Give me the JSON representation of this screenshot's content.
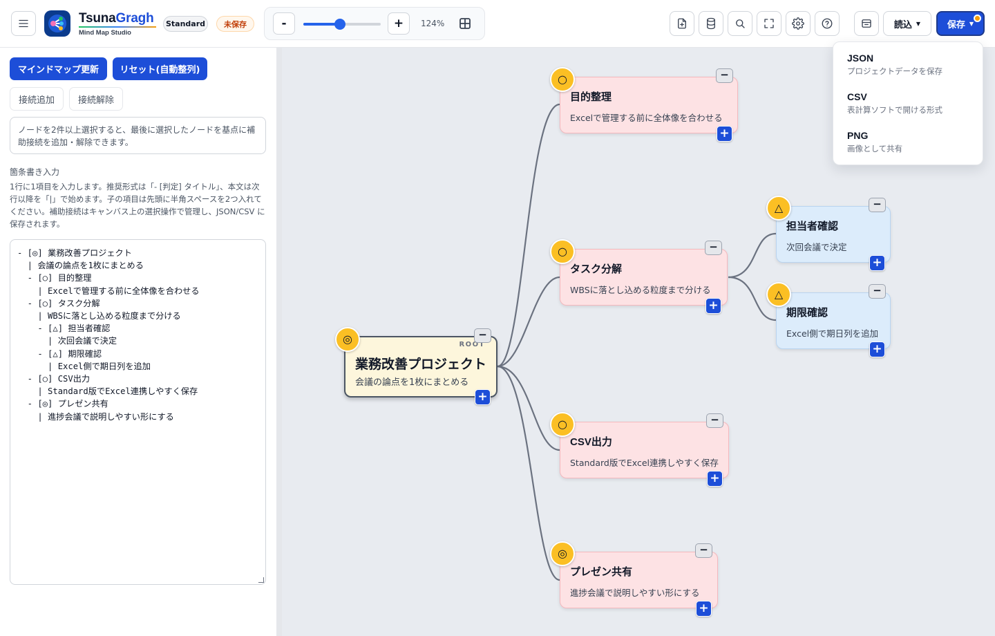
{
  "header": {
    "brand_name_1": "Tsuna",
    "brand_name_2": "Gragh",
    "brand_sub": "Mind Map Studio",
    "plan": "Standard",
    "status": "未保存",
    "zoom": {
      "minus": "-",
      "plus": "+",
      "value": "124%",
      "slider_fraction": 0.47
    },
    "read_label": "読込",
    "save_label": "保存",
    "caret": "▼"
  },
  "save_menu": {
    "items": [
      {
        "title": "JSON",
        "desc": "プロジェクトデータを保存"
      },
      {
        "title": "CSV",
        "desc": "表計算ソフトで開ける形式"
      },
      {
        "title": "PNG",
        "desc": "画像として共有"
      }
    ]
  },
  "sidebar": {
    "update_button": "マインドマップ更新",
    "reset_button": "リセット(自動整列)",
    "add_link_button": "接続追加",
    "remove_link_button": "接続解除",
    "hint": "ノードを2件以上選択すると、最後に選択したノードを基点に補助接続を追加・解除できます。",
    "section_title": "箇条書き入力",
    "section_desc": "1行に1項目を入力します。推奨形式は「- [判定] タイトル」、本文は次行以降を「|」で始めます。子の項目は先頭に半角スペースを2つ入れてください。補助接続はキャンバス上の選択操作で管理し、JSON/CSV に保存されます。",
    "editor_lines": [
      "- [◎] 業務改善プロジェクト",
      "  | 会議の論点を1枚にまとめる",
      "  - [○] 目的整理",
      "    | Excelで管理する前に全体像を合わせる",
      "  - [○] タスク分解",
      "    | WBSに落とし込める粒度まで分ける",
      "    - [△] 担当者確認",
      "      | 次回会議で決定",
      "    - [△] 期限確認",
      "      | Excel側で期日列を追加",
      "  - [○] CSV出力",
      "    | Standard版でExcel連携しやすく保存",
      "  - [◎] プレゼン共有",
      "    | 進捗会議で説明しやすい形にする"
    ]
  },
  "mindmap": {
    "root": {
      "label": "ROOT",
      "title": "業務改善プロジェクト",
      "body": "会議の論点を1枚にまとめる",
      "mark": "◎"
    },
    "nodes": [
      {
        "title": "目的整理",
        "body": "Excelで管理する前に全体像を合わせる",
        "mark": "○"
      },
      {
        "title": "タスク分解",
        "body": "WBSに落とし込める粒度まで分ける",
        "mark": "○"
      },
      {
        "title": "担当者確認",
        "body": "次回会議で決定",
        "mark": "△"
      },
      {
        "title": "期限確認",
        "body": "Excel側で期日列を追加",
        "mark": "△"
      },
      {
        "title": "CSV出力",
        "body": "Standard版でExcel連携しやすく保存",
        "mark": "○"
      },
      {
        "title": "プレゼン共有",
        "body": "進捗会議で説明しやすい形にする",
        "mark": "◎"
      }
    ],
    "collapse_symbol": "−",
    "add_symbol": "+"
  },
  "colors": {
    "accent": "#1d4ed8",
    "badge": "#fbbf24",
    "node_fill": "#fde2e4",
    "child_fill": "#dcecfb",
    "root_fill": "#fdf6dc"
  },
  "icons": [
    "menu-icon",
    "app-logo-icon",
    "new-file-icon",
    "database-icon",
    "search-icon",
    "fullscreen-icon",
    "gear-icon",
    "help-icon",
    "panel-icon",
    "fit-view-icon"
  ]
}
